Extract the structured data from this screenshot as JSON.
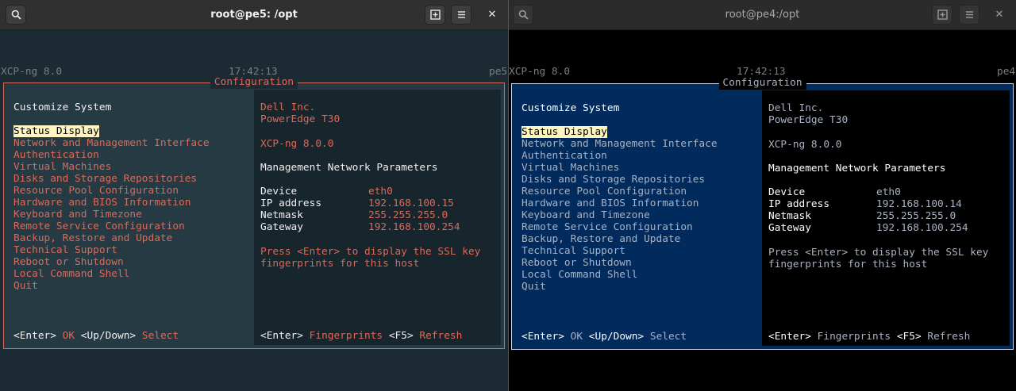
{
  "left": {
    "title": "root@pe5: /opt",
    "header": {
      "left": "XCP-ng 8.0",
      "center": "17:42:13",
      "right": "pe5"
    },
    "frame_title": "Configuration",
    "menu_heading": "Customize System",
    "menu_items": [
      "Status Display",
      "Network and Management Interface",
      "Authentication",
      "Virtual Machines",
      "Disks and Storage Repositories",
      "Resource Pool Configuration",
      "Hardware and BIOS Information",
      "Keyboard and Timezone",
      "Remote Service Configuration",
      "Backup, Restore and Update",
      "Technical Support",
      "Reboot or Shutdown",
      "Local Command Shell",
      "Quit"
    ],
    "vendor": "Dell Inc.",
    "model": "PowerEdge T30",
    "version": "XCP-ng 8.0.0",
    "net_heading": "Management Network Parameters",
    "net_rows": [
      {
        "label": "Device",
        "value": "eth0"
      },
      {
        "label": "IP address",
        "value": "192.168.100.15"
      },
      {
        "label": "Netmask",
        "value": "255.255.255.0"
      },
      {
        "label": "Gateway",
        "value": "192.168.100.254"
      }
    ],
    "hint_line1": "Press <Enter> to display the SSL key",
    "hint_line2": "fingerprints for this host",
    "footer_left": {
      "key1": "<Enter>",
      "act1": "OK",
      "key2": "<Up/Down>",
      "act2": "Select"
    },
    "footer_right": {
      "key1": "<Enter>",
      "act1": "Fingerprints",
      "key2": "<F5>",
      "act2": "Refresh"
    }
  },
  "right": {
    "title": "root@pe4:/opt",
    "header": {
      "left": "XCP-ng 8.0",
      "center": "17:42:13",
      "right": "pe4"
    },
    "frame_title": "Configuration",
    "menu_heading": "Customize System",
    "menu_items": [
      "Status Display",
      "Network and Management Interface",
      "Authentication",
      "Virtual Machines",
      "Disks and Storage Repositories",
      "Resource Pool Configuration",
      "Hardware and BIOS Information",
      "Keyboard and Timezone",
      "Remote Service Configuration",
      "Backup, Restore and Update",
      "Technical Support",
      "Reboot or Shutdown",
      "Local Command Shell",
      "Quit"
    ],
    "vendor": "Dell Inc.",
    "model": "PowerEdge T30",
    "version": "XCP-ng 8.0.0",
    "net_heading": "Management Network Parameters",
    "net_rows": [
      {
        "label": "Device",
        "value": "eth0"
      },
      {
        "label": "IP address",
        "value": "192.168.100.14"
      },
      {
        "label": "Netmask",
        "value": "255.255.255.0"
      },
      {
        "label": "Gateway",
        "value": "192.168.100.254"
      }
    ],
    "hint_line1": "Press <Enter> to display the SSL key",
    "hint_line2": "fingerprints for this host",
    "footer_left": {
      "key1": "<Enter>",
      "act1": "OK",
      "key2": "<Up/Down>",
      "act2": "Select"
    },
    "footer_right": {
      "key1": "<Enter>",
      "act1": "Fingerprints",
      "key2": "<F5>",
      "act2": "Refresh"
    }
  },
  "colors": {
    "left_panel_bg": "#263a44",
    "left_right_panel_bg": "#17252c",
    "left_accent": "#d96a5a",
    "right_panel_bg": "#002b5c",
    "right_right_panel_bg": "#000000",
    "highlight_bg": "#fff5c0"
  }
}
